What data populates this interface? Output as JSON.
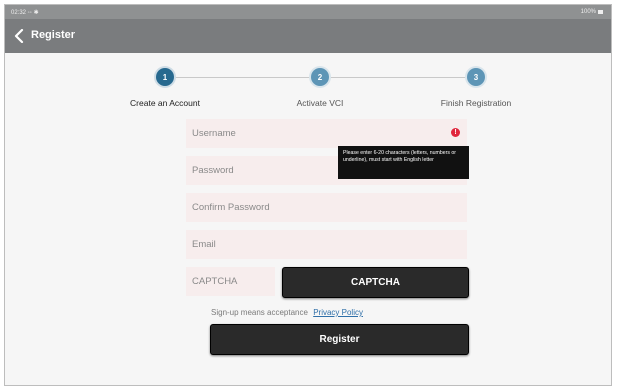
{
  "statusbar": {
    "time": "02:32 ◦◦  ✱",
    "battery": "100%"
  },
  "header": {
    "title": "Register",
    "back_icon": "chevron-left-icon"
  },
  "steps": [
    {
      "number": "1",
      "label": "Create an Account",
      "active": true
    },
    {
      "number": "2",
      "label": "Activate VCI",
      "active": false
    },
    {
      "number": "3",
      "label": "Finish Registration",
      "active": false
    }
  ],
  "form": {
    "username_placeholder": "Username",
    "password_placeholder": "Password",
    "confirm_password_placeholder": "Confirm Password",
    "email_placeholder": "Email",
    "captcha_placeholder": "CAPTCHA",
    "captcha_button": "CAPTCHA",
    "error_icon": "!",
    "error_tooltip": "Please enter 6-20 characters (letters, numbers or underline), must start with English letter",
    "agreement_text": "Sign-up means acceptance",
    "privacy_link": "Privacy Policy",
    "register_button": "Register"
  },
  "colors": {
    "title_bar": "#7a7c7e",
    "step_active": "#27698f",
    "step_inactive": "#5d95b6",
    "field_bg": "#f7eded",
    "error_red": "#e0263c",
    "button_dark": "#2a2a2a",
    "link_blue": "#2f6fa8"
  }
}
